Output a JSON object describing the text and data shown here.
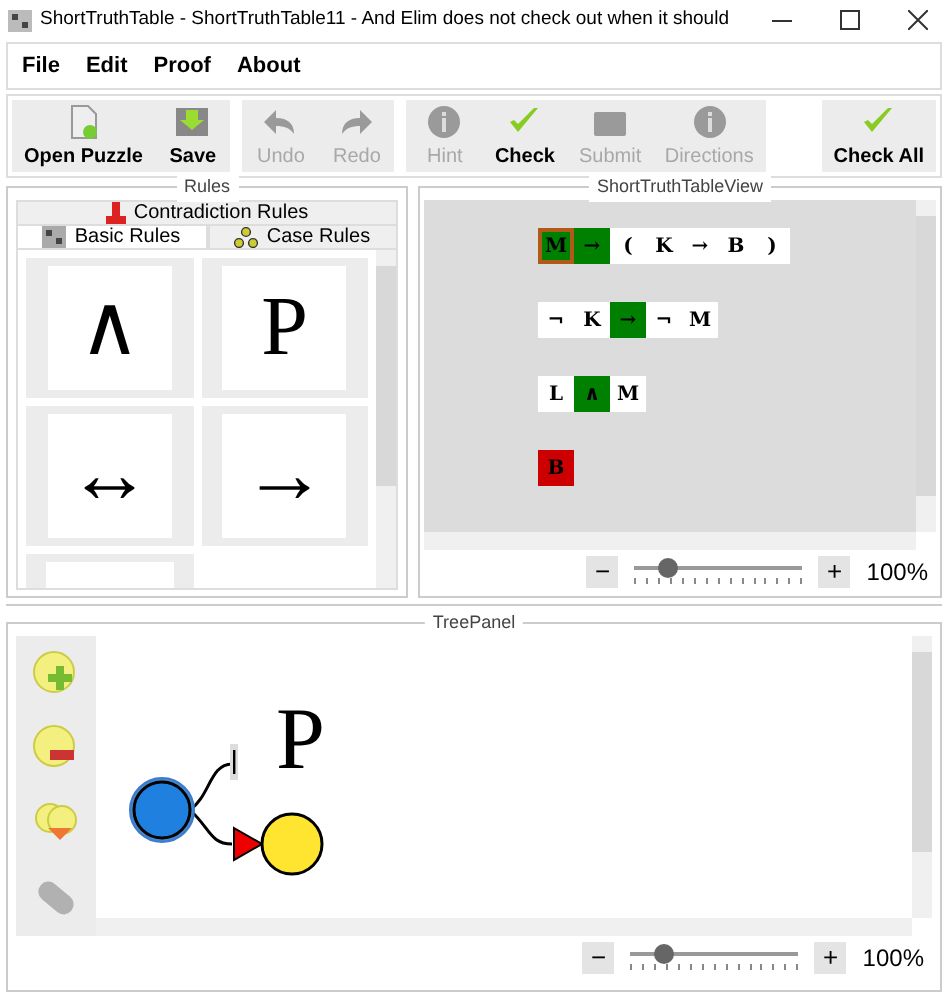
{
  "window": {
    "title": "ShortTruthTable - ShortTruthTable11 - And Elim does not check out when it should"
  },
  "menu": [
    "File",
    "Edit",
    "Proof",
    "About"
  ],
  "toolbar": [
    [
      {
        "label": "Open Puzzle",
        "kind": "open",
        "disabled": false
      },
      {
        "label": "Save",
        "kind": "save",
        "disabled": false
      }
    ],
    [
      {
        "label": "Undo",
        "kind": "undo",
        "disabled": true
      },
      {
        "label": "Redo",
        "kind": "redo",
        "disabled": true
      }
    ],
    [
      {
        "label": "Hint",
        "kind": "info",
        "disabled": true
      },
      {
        "label": "Check",
        "kind": "check",
        "disabled": false
      },
      {
        "label": "Submit",
        "kind": "submit",
        "disabled": true
      },
      {
        "label": "Directions",
        "kind": "info",
        "disabled": true
      }
    ],
    [
      {
        "label": "Check All",
        "kind": "check",
        "disabled": false
      }
    ]
  ],
  "rules": {
    "title": "Rules",
    "tab_rows": [
      [
        {
          "label": "Contradiction Rules",
          "kind": "contradiction",
          "selected": false
        }
      ],
      [
        {
          "label": "Basic Rules",
          "kind": "basic",
          "selected": true
        },
        {
          "label": "Case Rules",
          "kind": "case",
          "selected": false
        }
      ]
    ],
    "tiles": [
      "∧",
      "P",
      "↔",
      "→"
    ]
  },
  "view": {
    "title": "ShortTruthTableView",
    "rows": [
      [
        {
          "text": "M",
          "color": "#008000",
          "selected": true
        },
        {
          "text": "→",
          "color": "#008000",
          "selected": false
        },
        {
          "text": "(",
          "selected": false
        },
        {
          "text": "K",
          "selected": false
        },
        {
          "text": "→",
          "selected": false
        },
        {
          "text": "B",
          "selected": false
        },
        {
          "text": ")",
          "selected": false
        }
      ],
      [
        {
          "text": "¬",
          "selected": false
        },
        {
          "text": "K",
          "selected": false
        },
        {
          "text": "→",
          "color": "#008000",
          "selected": false
        },
        {
          "text": "¬",
          "selected": false
        },
        {
          "text": "M",
          "selected": false
        }
      ],
      [
        {
          "text": "L",
          "selected": false
        },
        {
          "text": "∧",
          "color": "#008000",
          "selected": false
        },
        {
          "text": "M",
          "selected": false
        }
      ],
      [
        {
          "text": "B",
          "color": "#cc0000",
          "selected": false
        }
      ]
    ],
    "zoom": {
      "minus": "−",
      "plus": "+",
      "level": 0.2,
      "reading": "100%"
    }
  },
  "tree": {
    "title": "TreePanel",
    "tools": [
      {
        "kind": "add",
        "disabled": false
      },
      {
        "kind": "remove",
        "disabled": false
      },
      {
        "kind": "merge",
        "disabled": false
      },
      {
        "kind": "collapse",
        "disabled": true
      }
    ],
    "label": "P",
    "zoom": {
      "minus": "−",
      "plus": "+",
      "level": 0.2,
      "reading": "100%"
    }
  }
}
